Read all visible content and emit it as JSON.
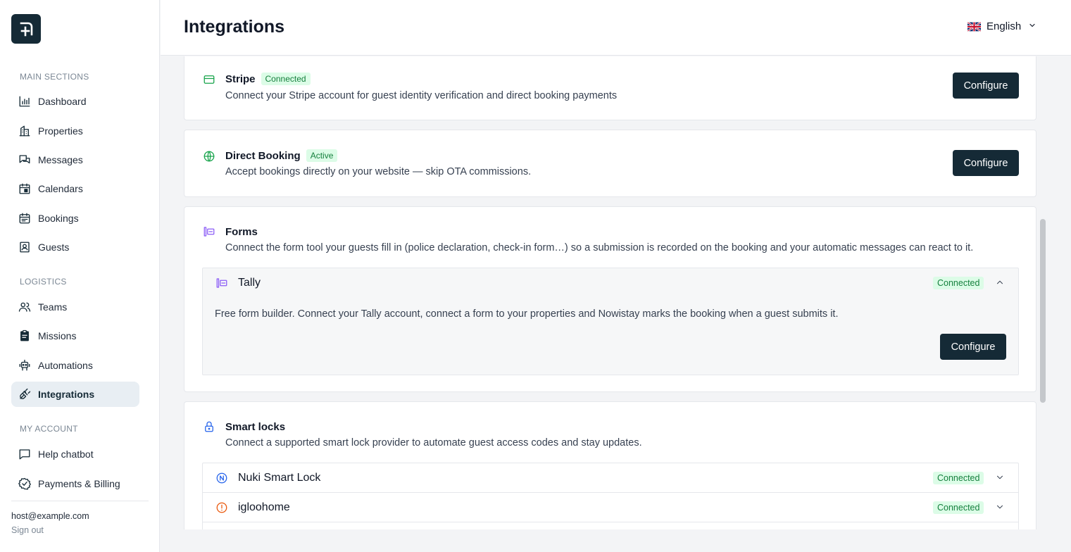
{
  "sidebar": {
    "sections": [
      {
        "label": "MAIN SECTIONS"
      },
      {
        "label": "LOGISTICS"
      },
      {
        "label": "MY ACCOUNT"
      }
    ],
    "items": [
      {
        "label": "Dashboard",
        "icon": "chart-bar-icon"
      },
      {
        "label": "Properties",
        "icon": "buildings-icon"
      },
      {
        "label": "Messages",
        "icon": "messages-icon"
      },
      {
        "label": "Calendars",
        "icon": "calendar-icon"
      },
      {
        "label": "Bookings",
        "icon": "bookings-icon"
      },
      {
        "label": "Guests",
        "icon": "guest-id-icon"
      },
      {
        "label": "Teams",
        "icon": "team-icon"
      },
      {
        "label": "Missions",
        "icon": "clipboard-icon"
      },
      {
        "label": "Automations",
        "icon": "robot-icon"
      },
      {
        "label": "Integrations",
        "icon": "plug-icon",
        "active": true
      },
      {
        "label": "Help chatbot",
        "icon": "chat-icon"
      },
      {
        "label": "Payments & Billing",
        "icon": "badge-check-icon"
      }
    ],
    "user_email": "host@example.com",
    "sign_out": "Sign out"
  },
  "header": {
    "title": "Integrations",
    "language": "English"
  },
  "cards": {
    "stripe": {
      "title": "Stripe",
      "badge": "Connected",
      "description": "Connect your Stripe account for guest identity verification and direct booking payments",
      "button": "Configure"
    },
    "direct_booking": {
      "title": "Direct Booking",
      "badge": "Active",
      "description": "Accept bookings directly on your website — skip OTA commissions.",
      "button": "Configure"
    },
    "forms": {
      "title": "Forms",
      "description": "Connect the form tool your guests fill in (police declaration, check-in form…) so a submission is recorded on the booking and your automatic messages can react to it.",
      "providers": [
        {
          "name": "Tally",
          "status": "Connected",
          "expanded": true,
          "description": "Free form builder. Connect your Tally account, connect a form to your properties and Nowistay marks the booking when a guest submits it.",
          "button": "Configure"
        }
      ]
    },
    "smart_locks": {
      "title": "Smart locks",
      "description": "Connect a supported smart lock provider to automate guest access codes and stay updates.",
      "providers": [
        {
          "name": "Nuki Smart Lock",
          "status": "Connected",
          "expanded": false
        },
        {
          "name": "igloohome",
          "status": "Connected",
          "expanded": false
        }
      ]
    }
  },
  "colors": {
    "primary": "#152a36",
    "badge_bg": "#dcfce7",
    "badge_text": "#15803d",
    "forms_icon": "#8b5cf6",
    "lock_icon": "#2563eb",
    "booking_icon": "#16a34a",
    "nuki_icon": "#2563eb",
    "igloo_icon": "#ea580c"
  }
}
